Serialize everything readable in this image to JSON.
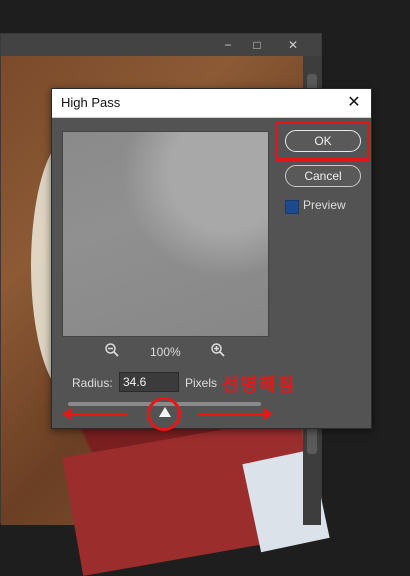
{
  "background_window": {
    "controls": {
      "minimize": "−",
      "maximize": "□",
      "close": "✕"
    }
  },
  "dialog": {
    "title": "High Pass",
    "close_label": "✕",
    "zoom": {
      "value": "100%",
      "zoom_out_icon": "zoom-out-icon",
      "zoom_in_icon": "zoom-in-icon"
    },
    "ok_label": "OK",
    "cancel_label": "Cancel",
    "preview_label": "Preview",
    "preview_checked": true,
    "radius_label": "Radius:",
    "radius_value": "34.6",
    "pixels_label": "Pixels",
    "slider_value_fraction": 0.5
  },
  "annotation": {
    "text": "선명해짐",
    "color": "#e41818"
  }
}
